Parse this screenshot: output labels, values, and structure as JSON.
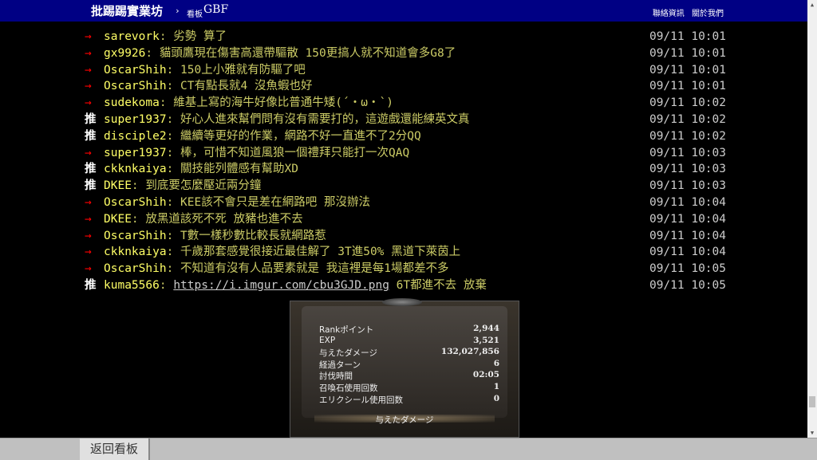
{
  "topbar": {
    "brand": "批踢踢實業坊",
    "separator": "›",
    "board_label": "看板",
    "board_name": "GBF",
    "links": [
      "聯絡資訊",
      "關於我們"
    ]
  },
  "pushes": [
    {
      "tag": "→",
      "type": "arrow",
      "user": "sarevork",
      "content": ": 劣勢 算了",
      "time": "09/11 10:01"
    },
    {
      "tag": "→",
      "type": "arrow",
      "user": "gx9926",
      "content": ": 貓頭鷹現在傷害高還帶驅散 150更搞人就不知道會多G8了",
      "time": "09/11 10:01"
    },
    {
      "tag": "→",
      "type": "arrow",
      "user": "OscarShih",
      "content": ": 150上小雅就有防驅了吧",
      "time": "09/11 10:01"
    },
    {
      "tag": "→",
      "type": "arrow",
      "user": "OscarShih",
      "content": ": CT有點長就4 沒魚蝦也好",
      "time": "09/11 10:01"
    },
    {
      "tag": "→",
      "type": "arrow",
      "user": "sudekoma",
      "content": ": 維基上寫的海牛好像比普通牛矮(´・ω・`)",
      "time": "09/11 10:02"
    },
    {
      "tag": "推",
      "type": "push",
      "user": "super1937",
      "content": ": 好心人進來幫們問有沒有需要打的，這遊戲還能練英文真",
      "time": "09/11 10:02"
    },
    {
      "tag": "推",
      "type": "push",
      "user": "disciple2",
      "content": ": 繼續等更好的作業，網路不好一直進不了2分QQ",
      "time": "09/11 10:02"
    },
    {
      "tag": "→",
      "type": "arrow",
      "user": "super1937",
      "content": ": 棒，可惜不知道風狼一個禮拜只能打一次QAQ",
      "time": "09/11 10:03"
    },
    {
      "tag": "推",
      "type": "push",
      "user": "ckknkaiya",
      "content": ": 關技能列體感有幫助XD",
      "time": "09/11 10:03"
    },
    {
      "tag": "推",
      "type": "push",
      "user": "DKEE",
      "content": ": 到底要怎麼壓近兩分鐘",
      "time": "09/11 10:03"
    },
    {
      "tag": "→",
      "type": "arrow",
      "user": "OscarShih",
      "content": ": KEE該不會只是差在網路吧 那沒辦法",
      "time": "09/11 10:04"
    },
    {
      "tag": "→",
      "type": "arrow",
      "user": "DKEE",
      "content": ": 放黑道該死不死 放豬也進不去",
      "time": "09/11 10:04"
    },
    {
      "tag": "→",
      "type": "arrow",
      "user": "OscarShih",
      "content": ": T數一樣秒數比較長就網路惹",
      "time": "09/11 10:04"
    },
    {
      "tag": "→",
      "type": "arrow",
      "user": "ckknkaiya",
      "content": ": 千歲那套感覺很接近最佳解了 3T進50% 黑道下萊茵上",
      "time": "09/11 10:04"
    },
    {
      "tag": "→",
      "type": "arrow",
      "user": "OscarShih",
      "content": ": 不知道有沒有人品要素就是 我這裡是每1場都差不多",
      "time": "09/11 10:05"
    },
    {
      "tag": "推",
      "type": "push",
      "user": "kuma5566",
      "content": ": ",
      "link": "https://i.imgur.com/cbu3GJD.png",
      "content_after": " 6T都進不去 放棄",
      "time": "09/11 10:05"
    }
  ],
  "embed": {
    "rows": [
      {
        "label": "Rankポイント",
        "value": "2,944"
      },
      {
        "label": "EXP",
        "value": "3,521"
      },
      {
        "label": "与えたダメージ",
        "value": "132,027,856"
      },
      {
        "label": "経過ターン",
        "value": "6"
      },
      {
        "label": "討伐時間",
        "value": "02:05"
      },
      {
        "label": "召喚石使用回数",
        "value": "1"
      },
      {
        "label": "エリクシール使用回数",
        "value": "0"
      }
    ],
    "footer": "与えたダメージ"
  },
  "bottombar": {
    "back_label": "返回看板"
  }
}
